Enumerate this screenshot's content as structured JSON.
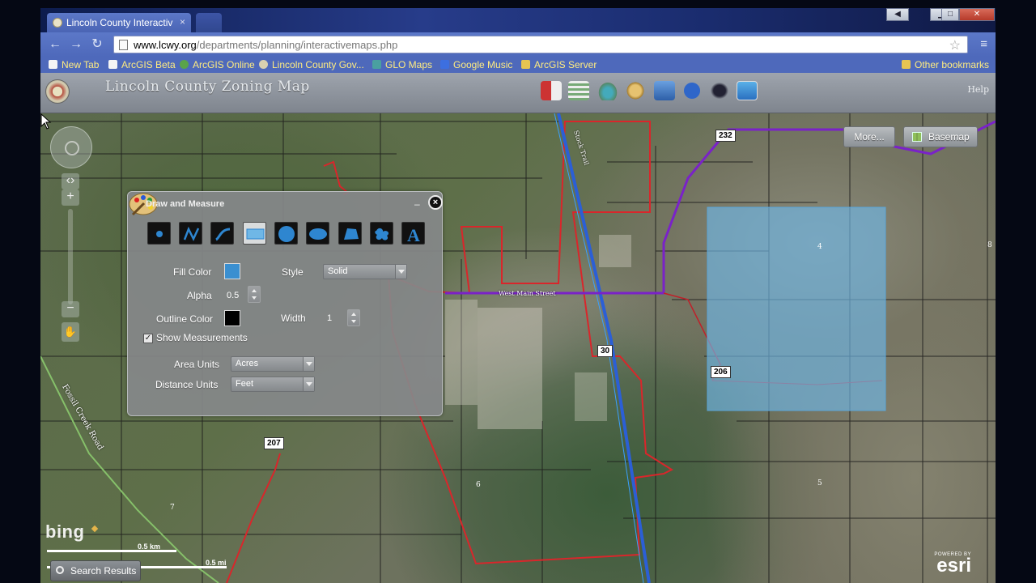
{
  "browser": {
    "tab_title": "Lincoln County Interactiv",
    "tab_close": "×",
    "url_host": "www.lcwy.org",
    "url_path": "/departments/planning/interactivemaps.php",
    "bookmarks": [
      "New Tab",
      "ArcGIS Beta",
      "ArcGIS Online",
      "Lincoln County Gov...",
      "GLO Maps",
      "Google Music",
      "ArcGIS Server"
    ],
    "other_bookmarks": "Other bookmarks"
  },
  "app": {
    "title": "Lincoln County Zoning Map",
    "help": "Help",
    "more_button": "More...",
    "basemap_button": "Basemap",
    "search_results": "Search Results",
    "bing": "bing",
    "esri_powered": "POWERED BY",
    "esri": "esri"
  },
  "scale": {
    "km": "0.5 km",
    "mi": "0.5 mi"
  },
  "map_labels": {
    "route_232": "232",
    "route_30": "30",
    "route_206": "206",
    "route_207": "207",
    "stock_trail": "Stock Trail",
    "west_main": "West Main Street",
    "fossil_creek": "Fossil Creek Road",
    "parcel_4": "4",
    "parcel_6": "6",
    "parcel_5": "5",
    "parcel_8": "8",
    "parcel_7": "7"
  },
  "draw_panel": {
    "title": "Draw and Measure",
    "minimize": "–",
    "close": "×",
    "fill_color_label": "Fill Color",
    "style_label": "Style",
    "style_value": "Solid",
    "alpha_label": "Alpha",
    "alpha_value": "0.5",
    "outline_color_label": "Outline Color",
    "width_label": "Width",
    "width_value": "1",
    "show_measurements_label": "Show Measurements",
    "show_measurements_checked": true,
    "area_units_label": "Area Units",
    "area_units_value": "Acres",
    "distance_units_label": "Distance Units",
    "distance_units_value": "Feet",
    "fill_color": "#3a8fd0",
    "outline_color": "#000000",
    "tools": [
      "point-tool",
      "polyline-tool",
      "freehand-line-tool",
      "rectangle-tool",
      "circle-tool",
      "ellipse-tool",
      "polygon-tool",
      "freehand-polygon-tool",
      "text-tool"
    ]
  },
  "colors": {
    "zoning_boundary": "#d9262b",
    "highway": "#2b5fd6",
    "county_road": "#7a22c8",
    "measure_fill": "#6fb7e6"
  }
}
